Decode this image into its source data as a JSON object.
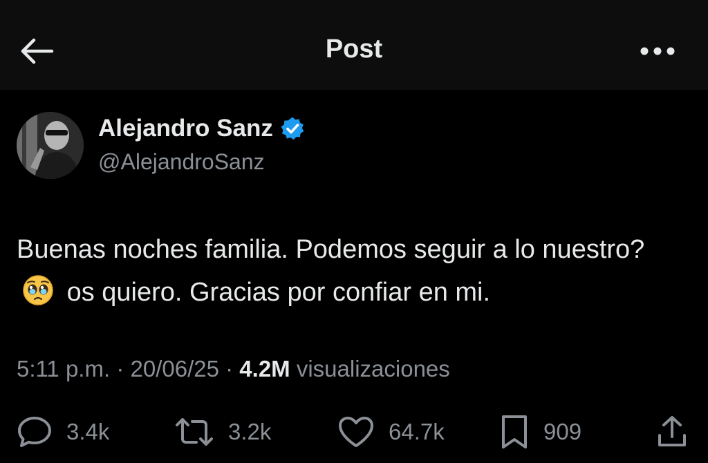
{
  "header": {
    "title": "Post",
    "back_icon": "arrow-left-icon",
    "more_icon": "more-dots-icon"
  },
  "author": {
    "name": "Alejandro Sanz",
    "handle": "@AlejandroSanz",
    "verified": true,
    "verified_color": "#1d9bf0"
  },
  "post": {
    "text_part1": "Buenas noches familia. Podemos seguir a lo nuestro?",
    "emoji": "pleading-face-emoji",
    "text_part2": "os quiero. Gracias por confiar en mi."
  },
  "meta": {
    "time": "5:11 p.m.",
    "separator": "·",
    "date": "20/06/25",
    "views_count": "4.2M",
    "views_label": "visualizaciones"
  },
  "actions": {
    "replies": "3.4k",
    "reposts": "3.2k",
    "likes": "64.7k",
    "bookmarks": "909",
    "share_icon": "share-icon"
  },
  "colors": {
    "background": "#000000",
    "header_background": "#0d0d0d",
    "primary_text": "#e7e9ea",
    "secondary_text": "#8b9096"
  }
}
